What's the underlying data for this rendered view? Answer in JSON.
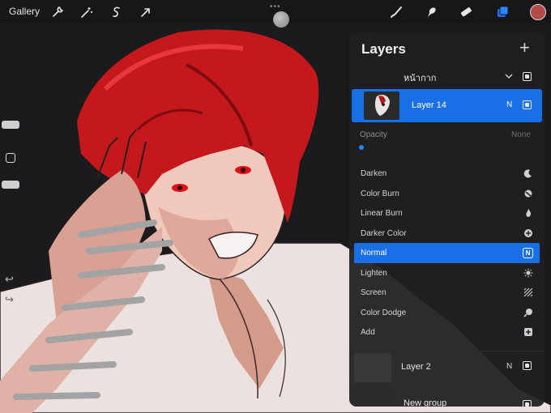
{
  "toolbar": {
    "gallery_label": "Gallery",
    "left_icons": [
      "wrench-icon",
      "magic-wand-icon",
      "selection-icon",
      "transform-arrow-icon"
    ],
    "right_icons": [
      "brush-icon",
      "smudge-icon",
      "eraser-icon",
      "layers-icon"
    ],
    "more_indicator": "•••",
    "current_color": "#b54a46",
    "accent_color": "#1970e6"
  },
  "sidebar": {
    "icons": [
      "brush-size-slider",
      "modify-square-icon",
      "opacity-slider",
      "undo-icon",
      "redo-icon"
    ],
    "undo_glyph": "↩",
    "redo_glyph": "↪"
  },
  "layers_panel": {
    "title": "Layers",
    "add_glyph": "+",
    "group_top": {
      "name": "หน้ากาก",
      "visible": true
    },
    "selected_layer": {
      "name": "Layer 14",
      "blend_badge": "N",
      "visible": true
    },
    "opacity": {
      "label": "Opacity",
      "value_label": "None"
    },
    "blend_modes": [
      {
        "label": "Darken",
        "icon": "moon-icon"
      },
      {
        "label": "Color Burn",
        "icon": "burn-icon"
      },
      {
        "label": "Linear Burn",
        "icon": "flame-icon"
      },
      {
        "label": "Darker Color",
        "icon": "plus-circle-icon"
      },
      {
        "label": "Normal",
        "icon": "n-badge-icon",
        "active": true,
        "badge": "N"
      },
      {
        "label": "Lighten",
        "icon": "sun-icon"
      },
      {
        "label": "Screen",
        "icon": "screen-icon"
      },
      {
        "label": "Color Dodge",
        "icon": "dodge-icon"
      },
      {
        "label": "Add",
        "icon": "add-square-icon"
      }
    ],
    "layer2": {
      "name": "Layer 2",
      "blend_badge": "N",
      "visible": true
    },
    "group_bottom": {
      "name": "New group",
      "visible": true
    }
  }
}
